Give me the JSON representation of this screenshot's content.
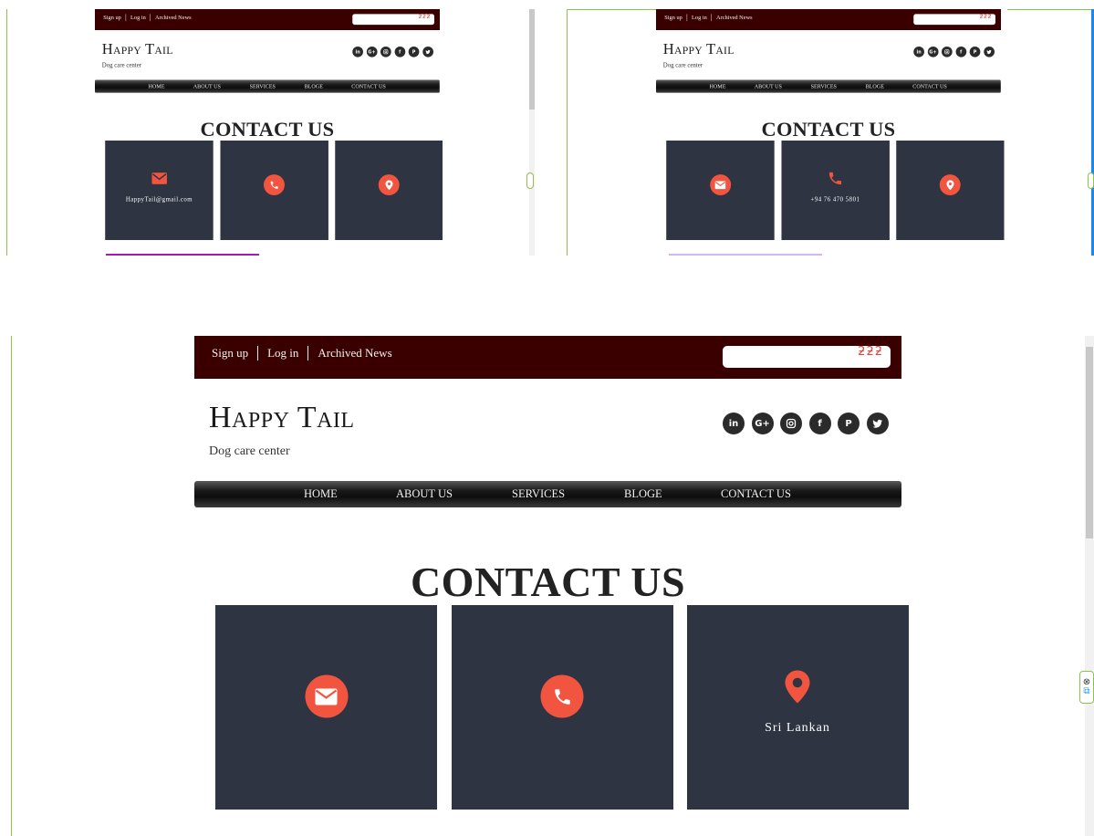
{
  "topbar": {
    "links": [
      "Sign up",
      "Log in",
      "Archived News"
    ],
    "search_placeholder": "",
    "search_glyph": "ƻƻƻ"
  },
  "brand": {
    "title": "Happy Tail",
    "subtitle": "Dog care center"
  },
  "social": [
    {
      "icon": "linkedin-icon",
      "glyph": "in"
    },
    {
      "icon": "google-plus-icon",
      "glyph": "G+"
    },
    {
      "icon": "instagram-icon",
      "glyph": ""
    },
    {
      "icon": "facebook-icon",
      "glyph": "f"
    },
    {
      "icon": "pinterest-icon",
      "glyph": "P"
    },
    {
      "icon": "twitter-icon",
      "glyph": ""
    }
  ],
  "nav": [
    "HOME",
    "ABOUT US",
    "SERVICES",
    "BLOGE",
    "CONTACT US"
  ],
  "contact": {
    "title": "CONTACT US",
    "email": "HappyTail@gmail.com",
    "phone": "+94 76 470 5801",
    "location": "Sri Lankan"
  },
  "colors": {
    "topbar": "#3a0000",
    "card": "#2f3442",
    "accent": "#f2553f"
  },
  "widget": {
    "close_glyph": "⊗",
    "copy_glyph": "⧉"
  }
}
